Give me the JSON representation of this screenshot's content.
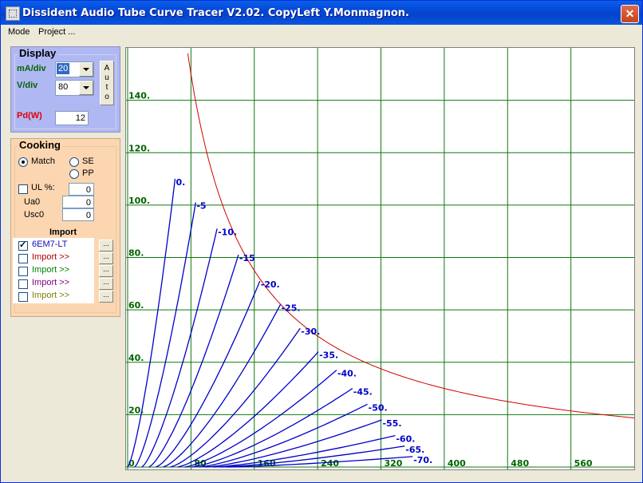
{
  "window": {
    "title": "Dissident Audio Tube Curve Tracer V2.02. CopyLeft Y.Monmagnon.",
    "close_glyph": "✕"
  },
  "menu": [
    "Mode",
    "Project ..."
  ],
  "display": {
    "legend": "Display",
    "ma_div_label": "mA/div",
    "ma_div_value": "20",
    "v_div_label": "V/div",
    "v_div_value": "80",
    "auto_letters": [
      "A",
      "u",
      "t",
      "o"
    ],
    "pd_label": "Pd(W)",
    "pd_value": "12"
  },
  "cooking": {
    "legend": "Cooking",
    "radio_match": "Match",
    "radio_se": "SE",
    "radio_pp": "PP",
    "ul_label": "UL  %:",
    "ul_value": "0",
    "ua0_label": "Ua0",
    "ua0_value": "0",
    "usc0_label": "Usc0",
    "usc0_value": "0",
    "import_header": "Import",
    "import_rows": [
      {
        "label": "6EM7-LT",
        "checked": true,
        "color": "#1010b0"
      },
      {
        "label": "Import >>",
        "checked": false,
        "color": "#b00000"
      },
      {
        "label": "Import >>",
        "checked": false,
        "color": "#008000"
      },
      {
        "label": "Import >>",
        "checked": false,
        "color": "#800080"
      },
      {
        "label": "Import >>",
        "checked": false,
        "color": "#808000"
      }
    ],
    "browse_label": "..."
  },
  "colors": {
    "grid": "#107810",
    "curve": "#0000c8",
    "pd_hyperbola": "#d00000",
    "label_green": "#006400",
    "pd_red": "#e00000"
  },
  "chart_data": {
    "type": "line",
    "title": "",
    "xlabel": "",
    "ylabel": "",
    "x_ticks": [
      0,
      80,
      160,
      240,
      320,
      400,
      480,
      560
    ],
    "x_tick_labels": [
      "0",
      "80",
      "160",
      "240",
      "320",
      "400",
      "480",
      "560"
    ],
    "y_ticks": [
      20,
      40,
      60,
      80,
      100,
      120,
      140
    ],
    "y_tick_labels": [
      "20.",
      "40.",
      "60.",
      "80.",
      "100.",
      "120.",
      "140."
    ],
    "xlim": [
      0,
      640
    ],
    "ylim": [
      0,
      160
    ],
    "grid": true,
    "pd_curve": {
      "watts": 12,
      "label": "Pd(W)"
    },
    "series": [
      {
        "name": "0.",
        "end": [
          60,
          110
        ]
      },
      {
        "name": "-5",
        "end": [
          86,
          101
        ]
      },
      {
        "name": "-10.",
        "end": [
          113,
          91
        ]
      },
      {
        "name": "-15",
        "end": [
          140,
          81
        ]
      },
      {
        "name": "-20.",
        "end": [
          167,
          71
        ]
      },
      {
        "name": "-25.",
        "end": [
          193,
          62
        ]
      },
      {
        "name": "-30.",
        "end": [
          218,
          53
        ]
      },
      {
        "name": "-35.",
        "end": [
          241,
          44
        ]
      },
      {
        "name": "-40.",
        "end": [
          264,
          37
        ]
      },
      {
        "name": "-45.",
        "end": [
          284,
          30
        ]
      },
      {
        "name": "-50.",
        "end": [
          303,
          24
        ]
      },
      {
        "name": "-55.",
        "end": [
          321,
          18
        ]
      },
      {
        "name": "-60.",
        "end": [
          338,
          12
        ]
      },
      {
        "name": "-65.",
        "end": [
          350,
          8
        ]
      },
      {
        "name": "-70.",
        "end": [
          360,
          4
        ]
      }
    ]
  }
}
